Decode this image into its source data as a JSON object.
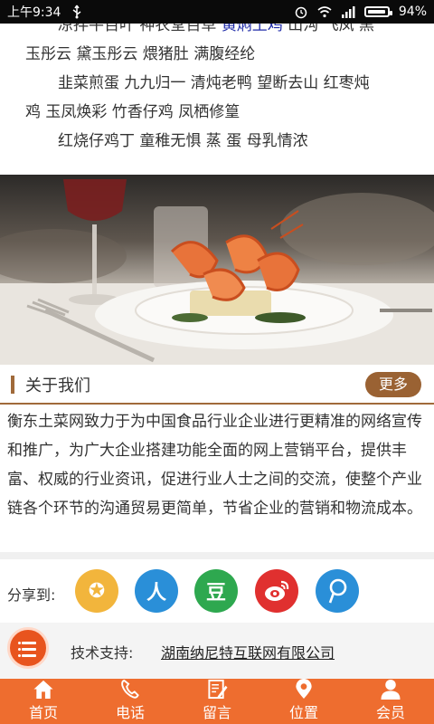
{
  "status_bar": {
    "time": "上午9:34",
    "battery_text": "94%",
    "battery_level": 0.94
  },
  "dishes": {
    "line1_pre": "凉拌牛百叶 神农堂百草 ",
    "line1_hl": "黄焖土鸡",
    "line1_post": " 山沟 飞凤 黑",
    "line2": "玉彤云 黛玉彤云 煨猪肚 满腹经纶",
    "line3": "韭菜煎蛋 九九归一 清炖老鸭 望断去山 红枣炖",
    "line4": "鸡 玉凤焕彩 竹香仔鸡 凤栖修篁",
    "line5": "红烧仔鸡丁 童稚无惧 蒸 蛋 母乳情浓"
  },
  "about": {
    "title": "关于我们",
    "more_label": "更多",
    "body": "衡东土菜网致力于为中国食品行业企业进行更精准的网络宣传和推广，为广大企业搭建功能全面的网上营销平台，提供丰富、权威的行业资讯，促进行业人士之间的交流，使整个产业链各个环节的沟通贸易更简单，节省企业的营销和物流成本。"
  },
  "share": {
    "label": "分享到:",
    "icons": [
      {
        "name": "qzone-icon",
        "glyph": "✪",
        "color": "#f2b53c"
      },
      {
        "name": "renren-icon",
        "glyph": "人",
        "color": "#2a8fd8"
      },
      {
        "name": "douban-icon",
        "glyph": "豆",
        "color": "#2ea84f"
      },
      {
        "name": "weibo-icon",
        "glyph": "",
        "color": "#e0302f"
      },
      {
        "name": "pengyou-icon",
        "glyph": "",
        "color": "#2a8fd8"
      }
    ]
  },
  "tech": {
    "label": "技术支持:",
    "company": "湖南纳尼特互联网有限公司"
  },
  "nav": [
    {
      "label": "首页",
      "icon": "home-icon"
    },
    {
      "label": "电话",
      "icon": "phone-icon"
    },
    {
      "label": "留言",
      "icon": "message-icon"
    },
    {
      "label": "位置",
      "icon": "location-icon"
    },
    {
      "label": "会员",
      "icon": "member-icon"
    }
  ]
}
